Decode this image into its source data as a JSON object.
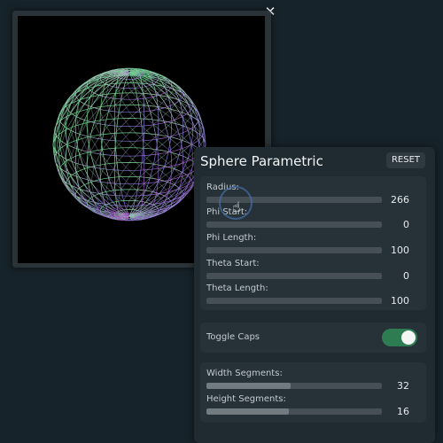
{
  "window": {
    "close_symbol": "✕"
  },
  "panel": {
    "title": "Sphere Parametric",
    "reset_label": "RESET",
    "sliders_main": [
      {
        "label": "Radius:",
        "value": "266",
        "fill": 0.0
      },
      {
        "label": "Phi Start:",
        "value": "0",
        "fill": 0.0
      },
      {
        "label": "Phi Length:",
        "value": "100",
        "fill": 0.0
      },
      {
        "label": "Theta Start:",
        "value": "0",
        "fill": 0.0
      },
      {
        "label": "Theta Length:",
        "value": "100",
        "fill": 0.0
      }
    ],
    "toggle": {
      "label": "Toggle Caps",
      "on": true
    },
    "sliders_segments": [
      {
        "label": "Width Segments:",
        "value": "32",
        "fill": 0.48
      },
      {
        "label": "Height Segments:",
        "value": "16",
        "fill": 0.47
      }
    ]
  },
  "colors": {
    "background": "#17232a",
    "panel": "#1f2b31",
    "toggle_on": "#2e7d52"
  },
  "icons": {
    "close": "close-icon",
    "cursor": "hand-pointer-icon"
  }
}
